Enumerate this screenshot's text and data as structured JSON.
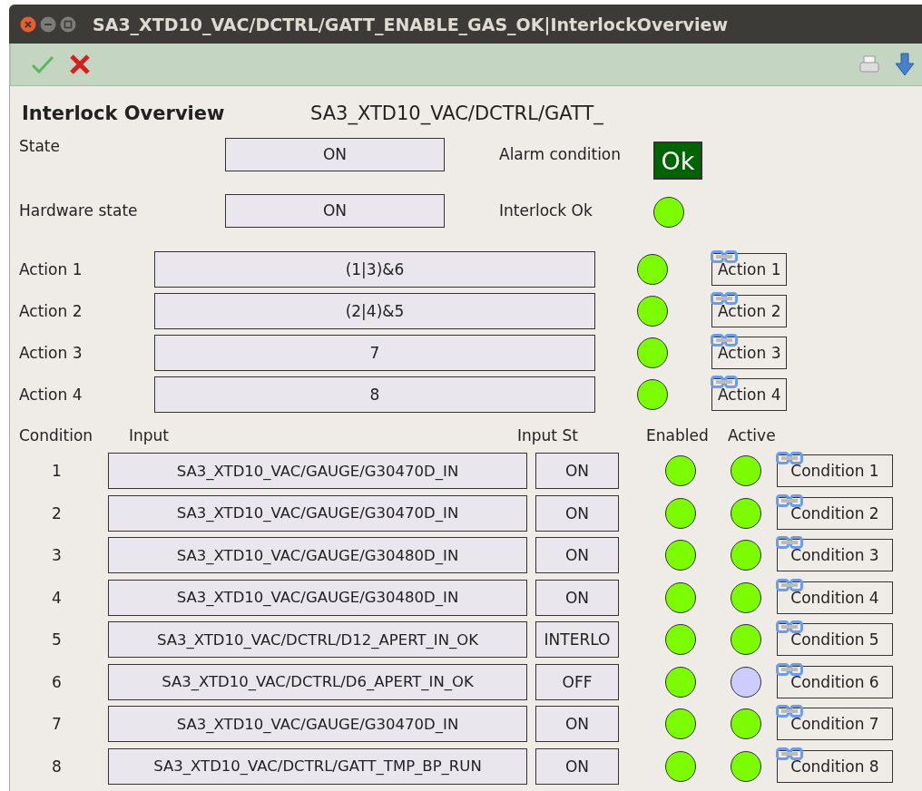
{
  "window": {
    "title": "SA3_XTD10_VAC/DCTRL/GATT_ENABLE_GAS_OK|InterlockOverview"
  },
  "header": {
    "title": "Interlock Overview",
    "device": "SA3_XTD10_VAC/DCTRL/GATT_"
  },
  "state": {
    "label": "State",
    "value": "ON"
  },
  "hardware_state": {
    "label": "Hardware state",
    "value": "ON"
  },
  "alarm": {
    "label": "Alarm condition",
    "value": "Ok",
    "ok": true
  },
  "interlock_ok": {
    "label": "Interlock Ok",
    "on": true
  },
  "actions": [
    {
      "label": "Action 1",
      "expression": "(1|3)&6",
      "on": true,
      "button": "Action 1"
    },
    {
      "label": "Action 2",
      "expression": "(2|4)&5",
      "on": true,
      "button": "Action 2"
    },
    {
      "label": "Action 3",
      "expression": "7",
      "on": true,
      "button": "Action 3"
    },
    {
      "label": "Action 4",
      "expression": "8",
      "on": true,
      "button": "Action 4"
    }
  ],
  "conditions": {
    "columns": [
      "Condition",
      "Input",
      "Input St",
      "Enabled",
      "Active"
    ],
    "rows": [
      {
        "number": "1",
        "input": "SA3_XTD10_VAC/GAUGE/G30470D_IN",
        "input_state": "ON",
        "enabled": true,
        "active": true,
        "button": "Condition 1"
      },
      {
        "number": "2",
        "input": "SA3_XTD10_VAC/GAUGE/G30470D_IN",
        "input_state": "ON",
        "enabled": true,
        "active": true,
        "button": "Condition 2"
      },
      {
        "number": "3",
        "input": "SA3_XTD10_VAC/GAUGE/G30480D_IN",
        "input_state": "ON",
        "enabled": true,
        "active": true,
        "button": "Condition 3"
      },
      {
        "number": "4",
        "input": "SA3_XTD10_VAC/GAUGE/G30480D_IN",
        "input_state": "ON",
        "enabled": true,
        "active": true,
        "button": "Condition 4"
      },
      {
        "number": "5",
        "input": "SA3_XTD10_VAC/DCTRL/D12_APERT_IN_OK",
        "input_state": "INTERLO",
        "enabled": true,
        "active": true,
        "button": "Condition 5"
      },
      {
        "number": "6",
        "input": "SA3_XTD10_VAC/DCTRL/D6_APERT_IN_OK",
        "input_state": "OFF",
        "enabled": true,
        "active": false,
        "button": "Condition 6"
      },
      {
        "number": "7",
        "input": "SA3_XTD10_VAC/GAUGE/G30470D_IN",
        "input_state": "ON",
        "enabled": true,
        "active": true,
        "button": "Condition 7"
      },
      {
        "number": "8",
        "input": "SA3_XTD10_VAC/DCTRL/GATT_TMP_BP_RUN",
        "input_state": "ON",
        "enabled": true,
        "active": true,
        "button": "Condition 8"
      }
    ]
  }
}
